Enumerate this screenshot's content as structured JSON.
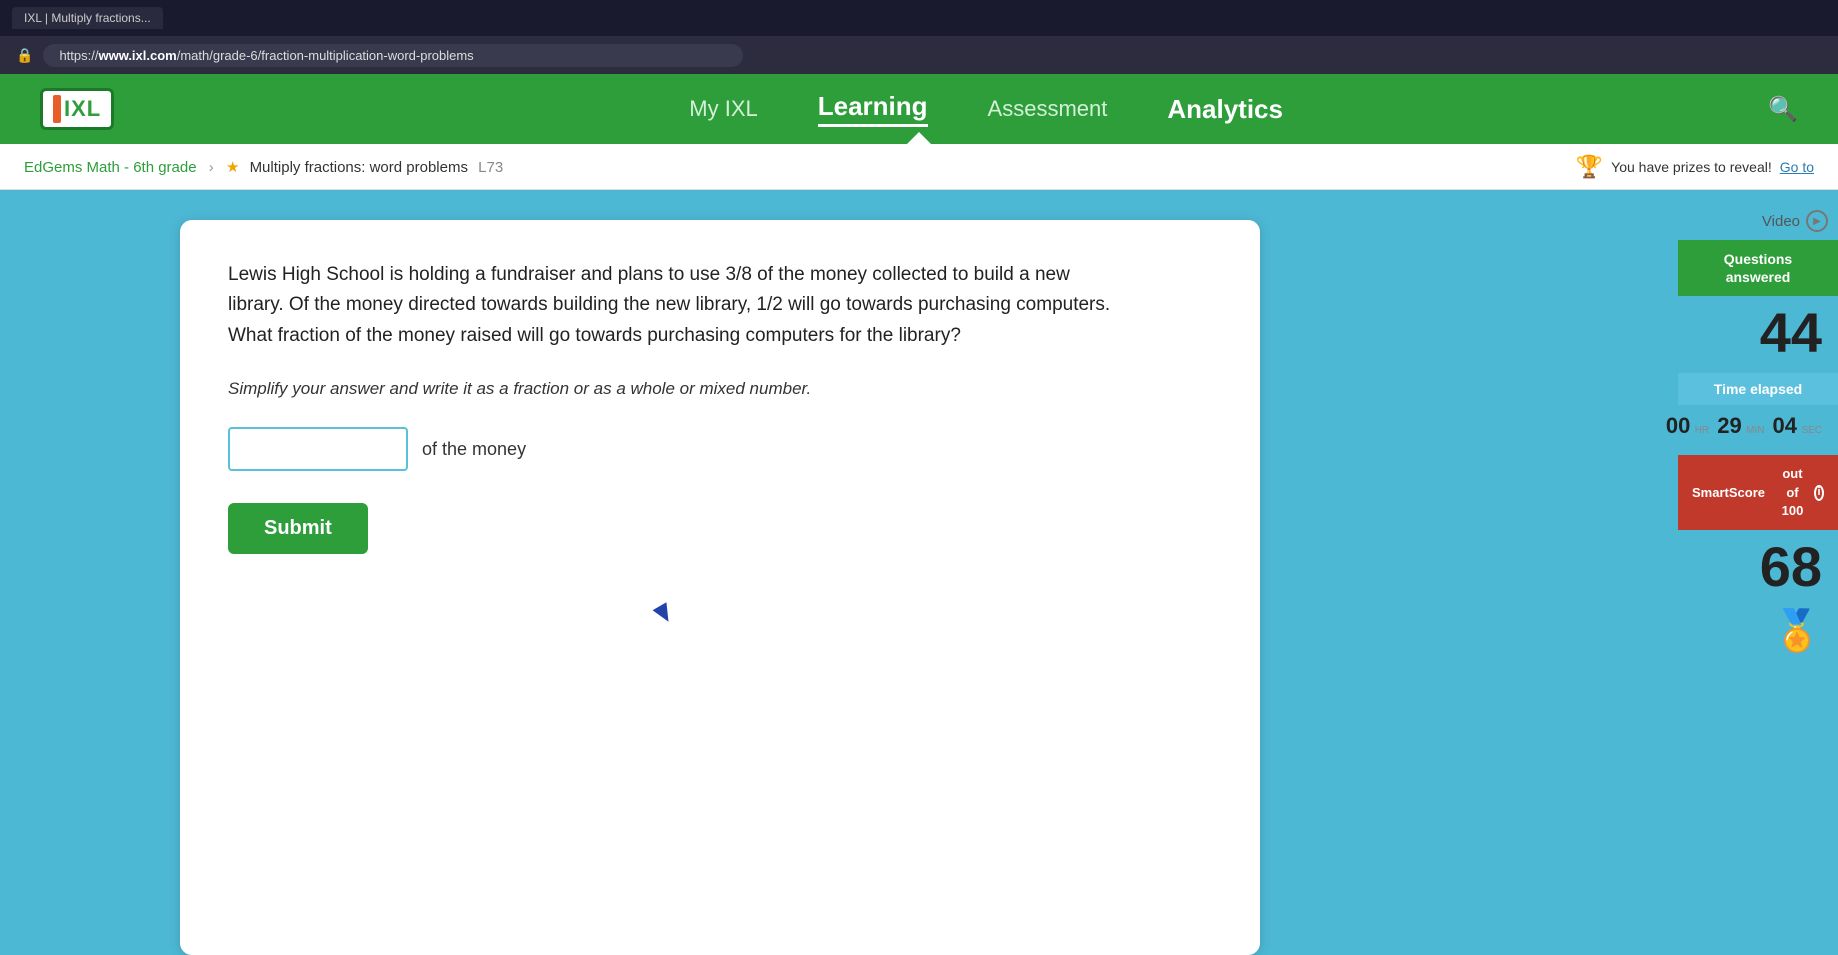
{
  "browser": {
    "tab_text": "IXL | Multiply fractions...",
    "address_prefix": "https://",
    "address_domain": "www.ixl.com",
    "address_path": "/math/grade-6/fraction-multiplication-word-problems"
  },
  "nav": {
    "logo_text": "IXL",
    "links": [
      {
        "id": "my-ixl",
        "label": "My IXL",
        "active": false
      },
      {
        "id": "learning",
        "label": "Learning",
        "active": true
      },
      {
        "id": "assessment",
        "label": "Assessment",
        "active": false
      },
      {
        "id": "analytics",
        "label": "Analytics",
        "active": false
      }
    ],
    "search_title": "Search"
  },
  "breadcrumb": {
    "parent": "EdGems Math - 6th grade",
    "current": "Multiply fractions: word problems",
    "level": "L73",
    "prize_text": "You have prizes to reveal!",
    "prize_link": "Go to"
  },
  "question": {
    "body": "Lewis High School is holding a fundraiser and plans to use 3/8 of the money collected to build a new library. Of the money directed towards building the new library, 1/2 will go towards purchasing computers. What fraction of the money raised will go towards purchasing computers for the library?",
    "instruction": "Simplify your answer and write it as a fraction or as a whole or mixed number.",
    "answer_placeholder": "",
    "answer_suffix": "of the money",
    "submit_label": "Submit"
  },
  "sidebar": {
    "video_label": "Video",
    "questions_answered_label": "Questions answered",
    "questions_answered_value": "44",
    "time_elapsed_label": "Time elapsed",
    "time_hours": "00",
    "time_minutes": "29",
    "time_seconds": "04",
    "time_hours_label": "hr",
    "time_minutes_label": "min",
    "time_seconds_label": "sec",
    "smart_score_label": "SmartScore",
    "smart_score_sub": "out of 100",
    "smart_score_value": "68"
  }
}
